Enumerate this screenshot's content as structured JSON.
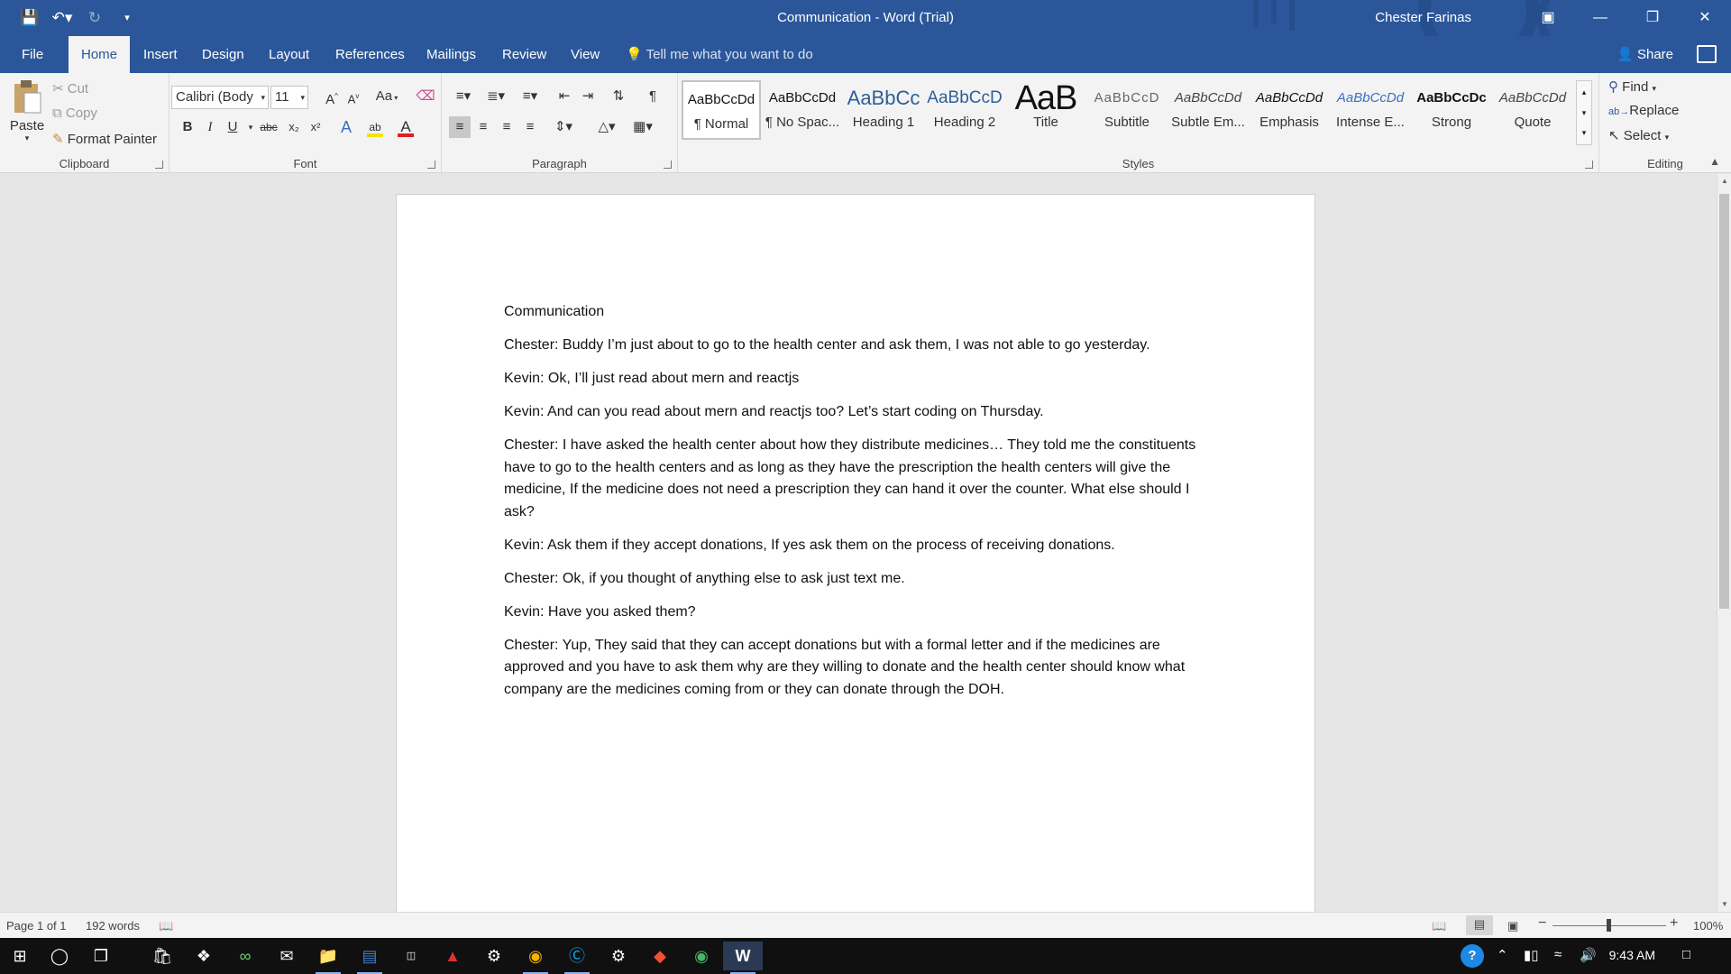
{
  "window": {
    "title": "Communication  -  Word (Trial)",
    "user": "Chester Farinas"
  },
  "tabs": [
    "File",
    "Home",
    "Insert",
    "Design",
    "Layout",
    "References",
    "Mailings",
    "Review",
    "View"
  ],
  "tell_me": "Tell me what you want to do",
  "share": "Share",
  "clipboard": {
    "paste": "Paste",
    "cut": "Cut",
    "copy": "Copy",
    "format_painter": "Format Painter",
    "label": "Clipboard"
  },
  "font": {
    "name": "Calibri (Body",
    "size": "11",
    "label": "Font",
    "bold": "B",
    "italic": "I",
    "underline": "U",
    "strike": "abc",
    "subscript": "x₂",
    "superscript": "x²",
    "grow": "A",
    "shrink": "A",
    "case": "Aa",
    "highlight_color": "#f4e300",
    "font_color": "#e01f1f"
  },
  "paragraph": {
    "label": "Paragraph"
  },
  "styles": {
    "label": "Styles",
    "items": [
      {
        "preview": "AaBbCcDd",
        "name": "¶ Normal"
      },
      {
        "preview": "AaBbCcDd",
        "name": "¶ No Spac..."
      },
      {
        "preview": "AaBbCc",
        "name": "Heading 1"
      },
      {
        "preview": "AaBbCcD",
        "name": "Heading 2"
      },
      {
        "preview": "AaB",
        "name": "Title"
      },
      {
        "preview": "AaBbCcD",
        "name": "Subtitle"
      },
      {
        "preview": "AaBbCcDd",
        "name": "Subtle Em..."
      },
      {
        "preview": "AaBbCcDd",
        "name": "Emphasis"
      },
      {
        "preview": "AaBbCcDd",
        "name": "Intense E..."
      },
      {
        "preview": "AaBbCcDc",
        "name": "Strong"
      },
      {
        "preview": "AaBbCcDd",
        "name": "Quote"
      }
    ]
  },
  "editing": {
    "label": "Editing",
    "find": "Find",
    "replace": "Replace",
    "select": "Select"
  },
  "document": {
    "heading": "Communication",
    "paragraphs": [
      "Chester: Buddy I’m just about to go to the health center and ask them, I was not able to go yesterday.",
      "Kevin: Ok, I’ll just read about mern and reactjs",
      "Kevin: And can you read about mern and reactjs too? Let’s start coding on Thursday.",
      "Chester: I have asked the health center about how they distribute medicines… They told me the constituents have to go to the health centers and as long as they have the prescription the health centers will give the medicine, If the medicine does not need a prescription they can hand it over the counter. What else should I ask?",
      "Kevin: Ask them if they accept donations, If yes ask them on the process of receiving donations.",
      "Chester: Ok, if you thought of anything else to ask just text me.",
      "Kevin: Have you asked them?",
      "Chester: Yup, They said that they can accept donations but with a formal letter and if the medicines are approved and you have to ask them why are they willing to donate and the health center should know what company are the medicines coming from or they can donate through the DOH."
    ]
  },
  "status": {
    "page": "Page 1 of 1",
    "words": "192 words",
    "zoom": "100%",
    "zoom_level": 1.0
  },
  "taskbar": {
    "time": "9:43 AM"
  },
  "colors": {
    "word_blue": "#2b579a"
  }
}
